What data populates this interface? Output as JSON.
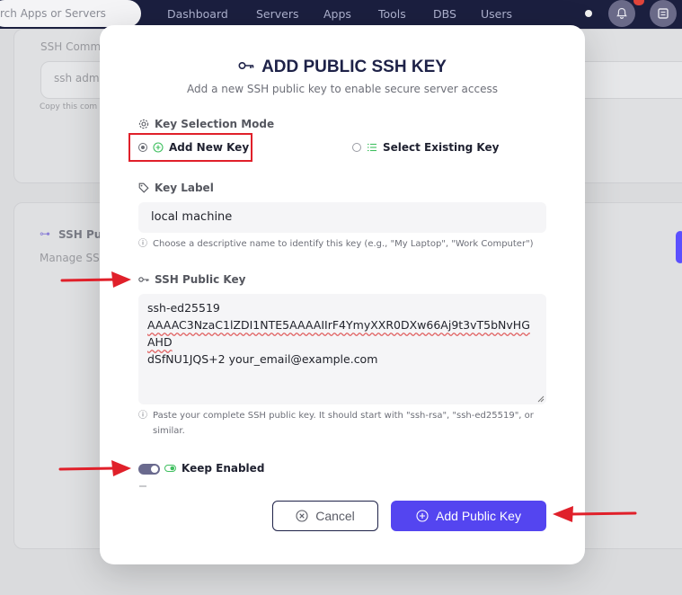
{
  "topbar": {
    "search_placeholder": "rch Apps or Servers",
    "nav": [
      "Dashboard",
      "Servers",
      "Apps",
      "Tools",
      "DBS",
      "Users"
    ]
  },
  "background": {
    "ssh_field_value": "ssh adm",
    "ssh_field_label": "SSH Comm",
    "copy_hint": "Copy this com",
    "section_title": "SSH Pu",
    "section_subtitle": "Manage SS"
  },
  "modal": {
    "title": "ADD PUBLIC SSH KEY",
    "subtitle": "Add a new SSH public key to enable secure server access",
    "mode_label": "Key Selection Mode",
    "options": {
      "add_new": "Add New Key",
      "select_existing": "Select Existing Key"
    },
    "key_label": {
      "label": "Key Label",
      "value": "local machine",
      "hint": "Choose a descriptive name to identify this key (e.g., \"My Laptop\", \"Work Computer\")"
    },
    "public_key": {
      "label": "SSH Public Key",
      "line1": "ssh-ed25519",
      "line2": "AAAAC3NzaC1lZDI1NTE5AAAAIIrF4YmyXXR0DXw66Aj9t3vT5bNvHGAHD",
      "line3": "dSfNU1JQS+2 your_email@example.com",
      "hint": "Paste your complete SSH public key. It should start with \"ssh-rsa\", \"ssh-ed25519\", or similar."
    },
    "keep_enabled_label": "Keep Enabled",
    "cancel_label": "Cancel",
    "submit_label": "Add Public Key"
  },
  "colors": {
    "accent": "#5445f0",
    "navy": "#1e2248",
    "annotation_red": "#e0202a",
    "green": "#3fbf5f"
  }
}
